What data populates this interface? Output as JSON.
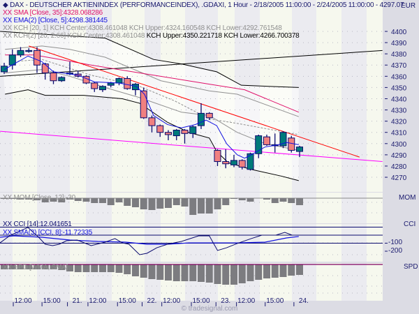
{
  "header": {
    "title": "DAX - DEUTSCHER AKTIENINDEX (PERFORMANCEINDEX), .GDAXI, 1 Hour - 2/18/2005 11:00:00 - 2/24/2005 11:00:00 - 4297.07",
    "currency": "EUR"
  },
  "legend": {
    "sma": "XX SMA [Close, 35]:4328.068286",
    "ema": "XX EMA(2) [Close, 5]:4298.381445",
    "kch1": "XX KCH [20, 1] KCH Center:4308.461048 KCH Upper:4324.160548 KCH Lower:4292.761548",
    "kch2_a": "XX KCH(2) [20, 2.66] KCH Center:4308.461048",
    "kch2_b": " KCH Upper:4350.221718 KCH Lower:4266.700378",
    "mom": "XX MOM [Close, 12]:-30",
    "cci": "XX CCI [14]:12.041651",
    "cci_sma": "XX SMA(3) [CCI, 8]:-11.72335",
    "spd": "XX SPD [WMA, SMA]"
  },
  "panels": {
    "mom": "MOM",
    "cci": "CCI",
    "spd": "SPD",
    "cci_ticks": [
      "-100",
      "-200"
    ]
  },
  "footer": "© tradesignal.com",
  "colors": {
    "up": "#007a7a",
    "down": "#f08080",
    "border": "#0a0a6e",
    "sma": "#e0106a",
    "ema": "#1010e0",
    "trend": "#ff0000",
    "magenta": "#ff00ff",
    "bar": "#7c7c80"
  },
  "chart_data": {
    "type": "candlestick",
    "title": "DAX - DEUTSCHER AKTIENINDEX (PERFORMANCEINDEX), .GDAXI, 1 Hour",
    "y_ticks": [
      "4400",
      "4390",
      "4380",
      "4370",
      "4360",
      "4350",
      "4340",
      "4330",
      "4320",
      "4310",
      "4300",
      "4290",
      "4280",
      "4270"
    ],
    "ylim": [
      4263,
      4400
    ],
    "x_labels": [
      "12:00",
      "15:00",
      "21.",
      "12:00",
      "15:00",
      "22.",
      "12:00",
      "15:00",
      "23.",
      "12:00",
      "15:00",
      "24."
    ],
    "x_label_index": [
      3.3,
      6.8,
      9.9,
      12.4,
      16.0,
      19.0,
      21.4,
      25.0,
      28.0,
      30.5,
      34.0,
      37.5
    ],
    "candles": [
      [
        4364,
        4372,
        4362,
        4369
      ],
      [
        4370,
        4384,
        4366,
        4379
      ],
      [
        4379,
        4386,
        4377,
        4383
      ],
      [
        4383,
        4385,
        4381,
        4383
      ],
      [
        4383,
        4386,
        4363,
        4370
      ],
      [
        4371,
        4372,
        4357,
        4363
      ],
      [
        4363,
        4365,
        4353,
        4356
      ],
      [
        4356,
        4360,
        4355,
        4359
      ],
      [
        4363,
        4373,
        4361,
        4363
      ],
      [
        4362,
        4365,
        4359,
        4360
      ],
      [
        4360,
        4361,
        4353,
        4354
      ],
      [
        4354,
        4355,
        4346,
        4349
      ],
      [
        4348,
        4352,
        4346,
        4351
      ],
      [
        4352,
        4355,
        4350,
        4354
      ],
      [
        4354,
        4359,
        4352,
        4358
      ],
      [
        4358,
        4360,
        4348,
        4349
      ],
      [
        4348,
        4354,
        4343,
        4353
      ],
      [
        4347,
        4350,
        4322,
        4323
      ],
      [
        4323,
        4325,
        4310,
        4316
      ],
      [
        4316,
        4317,
        4306,
        4310
      ],
      [
        4310,
        4312,
        4303,
        4308
      ],
      [
        4307,
        4313,
        4303,
        4312
      ],
      [
        4312,
        4313,
        4300,
        4309
      ],
      [
        4309,
        4316,
        4305,
        4315
      ],
      [
        4316,
        4336,
        4313,
        4327
      ],
      [
        4327,
        4328,
        4321,
        4323
      ],
      [
        4294,
        4295,
        4280,
        4284
      ],
      [
        4284,
        4295,
        4278,
        4282
      ],
      [
        4281,
        4290,
        4279,
        4285
      ],
      [
        4285,
        4286,
        4277,
        4279
      ],
      [
        4277,
        4292,
        4276,
        4291
      ],
      [
        4291,
        4308,
        4287,
        4307
      ],
      [
        4306,
        4308,
        4298,
        4299
      ],
      [
        4299,
        4309,
        4292,
        4299
      ],
      [
        4298,
        4311,
        4296,
        4310
      ],
      [
        4305,
        4307,
        4292,
        4294
      ],
      [
        4293,
        4298,
        4288,
        4297
      ]
    ],
    "lines": {
      "kch_upper_266": [
        [
          0.5,
          4400
        ],
        [
          4.7,
          4398
        ],
        [
          13.3,
          4394
        ],
        [
          19.2,
          4375
        ],
        [
          22.6,
          4371
        ],
        [
          26.9,
          4364
        ],
        [
          29.9,
          4352
        ],
        [
          36.9,
          4350
        ]
      ],
      "kch_lower_266": [
        [
          1.1,
          4344
        ],
        [
          3.9,
          4348
        ],
        [
          6.0,
          4343
        ],
        [
          10.7,
          4343
        ],
        [
          15.4,
          4340
        ],
        [
          17.5,
          4336
        ],
        [
          20.9,
          4319
        ],
        [
          23.5,
          4310
        ],
        [
          26.0,
          4305
        ],
        [
          26.9,
          4293
        ],
        [
          28.3,
          4283
        ],
        [
          31.1,
          4277
        ],
        [
          34.8,
          4271
        ],
        [
          36.9,
          4267
        ]
      ],
      "kch_upper_1": [
        [
          1.1,
          4384
        ],
        [
          5.6,
          4387
        ],
        [
          9.0,
          4384
        ],
        [
          13.3,
          4377
        ],
        [
          20.1,
          4356
        ],
        [
          26.0,
          4347
        ],
        [
          29.4,
          4344
        ],
        [
          36.9,
          4324
        ]
      ],
      "kch_center": [
        [
          1.8,
          4373
        ],
        [
          5.6,
          4375
        ],
        [
          11.6,
          4361
        ],
        [
          17.5,
          4351
        ],
        [
          21.8,
          4338
        ],
        [
          26.0,
          4322
        ],
        [
          29.4,
          4318
        ],
        [
          36.9,
          4308
        ]
      ],
      "kch_lower_1": [
        [
          1.1,
          4363
        ],
        [
          5.6,
          4366
        ],
        [
          9.0,
          4360
        ],
        [
          13.3,
          4350
        ],
        [
          17.5,
          4341
        ],
        [
          22.6,
          4328
        ],
        [
          26.0,
          4325
        ],
        [
          29.4,
          4310
        ],
        [
          32.8,
          4300
        ],
        [
          36.9,
          4294
        ]
      ],
      "sma35": [
        [
          1.1,
          4379
        ],
        [
          4.7,
          4379
        ],
        [
          11.6,
          4370
        ],
        [
          17.5,
          4363
        ],
        [
          26.0,
          4353
        ],
        [
          30.3,
          4348
        ],
        [
          36.9,
          4328
        ]
      ],
      "ema5": [
        [
          1,
          4366
        ],
        [
          3.9,
          4378
        ],
        [
          5.6,
          4373
        ],
        [
          7.0,
          4364
        ],
        [
          8.1,
          4363
        ],
        [
          10.0,
          4361
        ],
        [
          12.0,
          4355
        ],
        [
          15.0,
          4354
        ],
        [
          17.1,
          4351
        ],
        [
          18.1,
          4344
        ],
        [
          19.2,
          4325
        ],
        [
          20.9,
          4317
        ],
        [
          22.6,
          4314
        ],
        [
          24.3,
          4317
        ],
        [
          25.6,
          4321
        ],
        [
          26.9,
          4316
        ],
        [
          28.1,
          4300
        ],
        [
          29.4,
          4290
        ],
        [
          30.3,
          4287
        ],
        [
          31.1,
          4290
        ],
        [
          32.8,
          4297
        ],
        [
          34.5,
          4299
        ],
        [
          35.4,
          4301
        ],
        [
          36.9,
          4299
        ]
      ],
      "trend_down": [
        [
          4.0,
          4387
        ],
        [
          44.3,
          4288
        ]
      ],
      "trend_up": [
        [
          0.5,
          4360
        ],
        [
          47.1,
          4383
        ]
      ],
      "support": [
        [
          0.5,
          4311
        ],
        [
          47.1,
          4284
        ]
      ]
    },
    "mom": [
      -1,
      -1,
      -2,
      -2,
      -3,
      -6,
      -5,
      -6,
      -2,
      -4,
      -5,
      -7,
      -7,
      -10,
      -6,
      -11,
      -13,
      -16,
      -17,
      -15,
      -14,
      -10,
      -12,
      -24,
      -22,
      -22,
      -16,
      -10,
      -1,
      -3,
      -5,
      0,
      -2,
      -7,
      -5,
      -7,
      -10
    ],
    "cci": [
      [
        0.49,
        -96
      ],
      [
        1.77,
        0
      ],
      [
        3.9,
        96
      ],
      [
        5.2,
        -26
      ],
      [
        6.0,
        -113
      ],
      [
        6.9,
        -130
      ],
      [
        7.7,
        -113
      ],
      [
        8.6,
        -70
      ],
      [
        9.9,
        -61
      ],
      [
        11.6,
        -130
      ],
      [
        13.3,
        -87
      ],
      [
        14.5,
        -43
      ],
      [
        15.4,
        -96
      ],
      [
        16.2,
        -113
      ],
      [
        17.5,
        -243
      ],
      [
        18.4,
        -226
      ],
      [
        19.6,
        -157
      ],
      [
        20.9,
        -113
      ],
      [
        22.6,
        -78
      ],
      [
        24.7,
        -9
      ],
      [
        26.0,
        -9
      ],
      [
        27.0,
        -191
      ],
      [
        28.1,
        -157
      ],
      [
        29.4,
        -104
      ],
      [
        31.1,
        -43
      ],
      [
        32.4,
        0
      ],
      [
        34.1,
        0
      ],
      [
        35.2,
        35
      ],
      [
        36.1,
        0
      ],
      [
        36.9,
        0
      ]
    ],
    "cci_sma": [
      [
        0.49,
        -26
      ],
      [
        2.2,
        -9
      ],
      [
        5.6,
        -26
      ],
      [
        9.0,
        -61
      ],
      [
        12.4,
        -78
      ],
      [
        15.8,
        -87
      ],
      [
        18.4,
        -113
      ],
      [
        20.9,
        -113
      ],
      [
        23.5,
        -96
      ],
      [
        26.0,
        -96
      ],
      [
        29.4,
        -96
      ],
      [
        32.8,
        -87
      ],
      [
        35.4,
        -35
      ],
      [
        36.9,
        -17
      ]
    ],
    "spd": [
      -7,
      -7,
      -7,
      -7,
      -7,
      -7,
      -7,
      -8,
      -10,
      -11,
      -11,
      -11,
      -11,
      -11,
      -12,
      -14,
      -17,
      -19,
      -21,
      -22,
      -23,
      -24,
      -24,
      -24,
      -25,
      -26,
      -28,
      -29,
      -29,
      -27,
      -24,
      -22,
      -20,
      -19,
      -18,
      -16,
      -15
    ]
  }
}
